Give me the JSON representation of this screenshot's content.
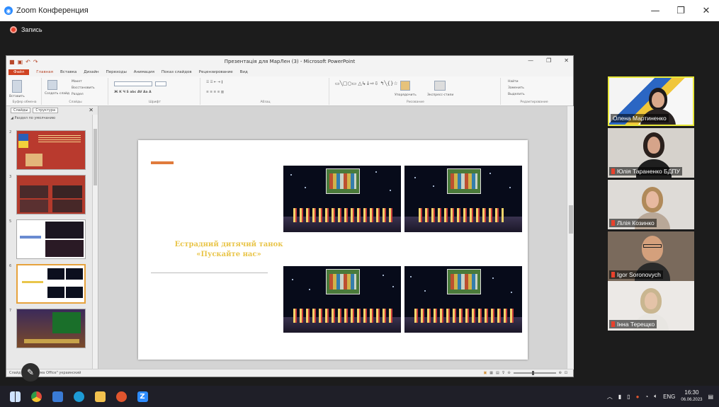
{
  "zoom": {
    "title": "Zoom Конференция",
    "recording_label": "Запись"
  },
  "powerpoint": {
    "doc_title": "Презентація для МарЛен (3) - Microsoft PowerPoint",
    "tabs": [
      "Файл",
      "Главная",
      "Вставка",
      "Дизайн",
      "Переходы",
      "Анимация",
      "Показ слайдов",
      "Рецензирование",
      "Вид"
    ],
    "ribbon_groups": [
      "Буфер обмена",
      "Слайды",
      "Шрифт",
      "Абзац",
      "Рисование",
      "Редактирование"
    ],
    "ribbon_items": {
      "paste": "Вставить",
      "create_slide": "Создать слайд",
      "layout": "Макет",
      "reset": "Восстановить",
      "section": "Раздел",
      "arrange": "Упорядочить",
      "express_styles": "Экспресс-стили",
      "find": "Найти",
      "replace": "Заменить",
      "select": "Выделить"
    },
    "pane_tabs": [
      "Слайды",
      "Структура"
    ],
    "pane_section": "Раздел по умолчанию",
    "slide_numbers": [
      "2",
      "3",
      "5",
      "6",
      "7"
    ],
    "slide_title_line1": "Естрадний дитячий танок",
    "slide_title_line2": "«Пускайте нас»",
    "status_text": "Слайд 4 из 8   \"Тема Office\"   украинский"
  },
  "participants": [
    {
      "name": "Олена Мартиненко"
    },
    {
      "name": "Юлія Тараненко БДПУ"
    },
    {
      "name": "Лілія Козинко"
    },
    {
      "name": "Igor Soronovych"
    },
    {
      "name": "Інна Терещко"
    }
  ],
  "taskbar": {
    "lang": "ENG",
    "time": "16:30",
    "date": "06.06.2023"
  },
  "colors": {
    "zoom_blue": "#2d8cff",
    "rec_red": "#e8412c",
    "ppt_file": "#d04423",
    "slide_title": "#e9c54a",
    "accent_orange": "#e07b3c",
    "active_speaker": "#e8e83a"
  }
}
